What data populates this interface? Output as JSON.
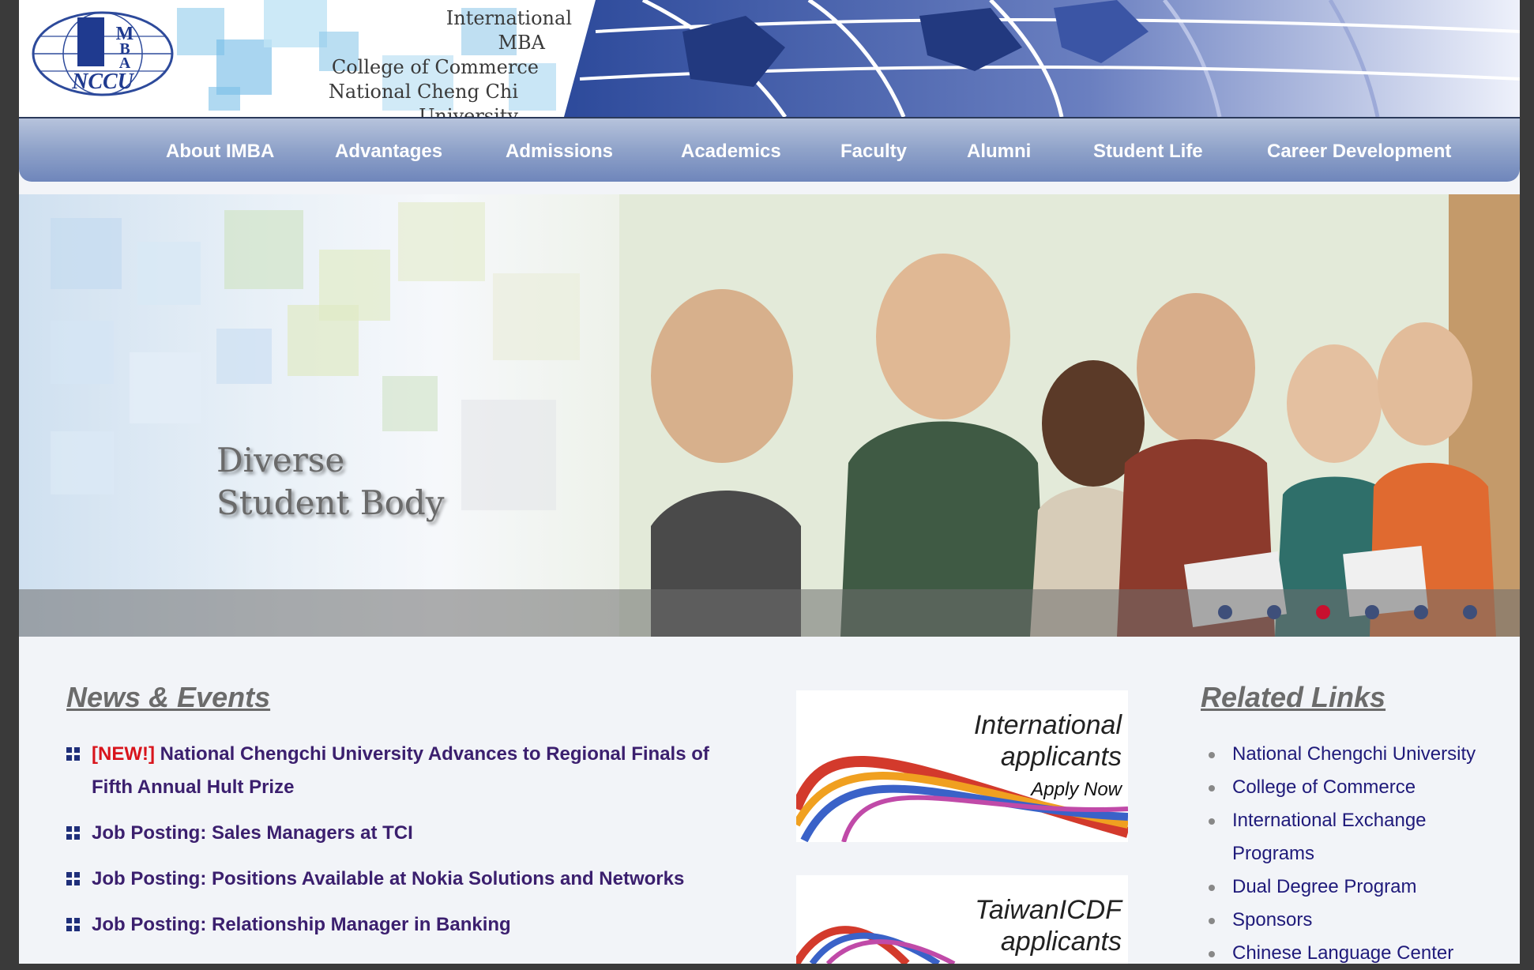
{
  "header": {
    "logo_text": "MBA NCCU",
    "title_lines": [
      "International",
      "MBA",
      "College of Commerce",
      "National Cheng Chi University"
    ]
  },
  "nav": {
    "items": [
      {
        "label": "About IMBA"
      },
      {
        "label": "Advantages"
      },
      {
        "label": "Admissions"
      },
      {
        "label": "Academics"
      },
      {
        "label": "Faculty"
      },
      {
        "label": "Alumni"
      },
      {
        "label": "Student Life"
      },
      {
        "label": "Career Development"
      }
    ]
  },
  "hero": {
    "caption_line1": "Diverse",
    "caption_line2": "Student Body",
    "slide_count": 6,
    "active_slide": 3
  },
  "news": {
    "title": "News & Events",
    "items": [
      {
        "new_tag": "[NEW!]",
        "line1": "National Chengchi University Advances to Regional Finals of",
        "line2": "Fifth Annual Hult Prize"
      },
      {
        "text": "Job Posting: Sales Managers at TCI"
      },
      {
        "text": "Job Posting: Positions Available at Nokia Solutions and Networks"
      },
      {
        "text": "Job Posting: Relationship Manager in Banking"
      }
    ]
  },
  "banners": [
    {
      "title_line1": "International",
      "title_line2": "applicants",
      "sub": "Apply Now"
    },
    {
      "title_line1": "TaiwanICDF",
      "title_line2": "applicants"
    }
  ],
  "related_links": {
    "title": "Related Links",
    "items": [
      "National Chengchi University",
      "College of Commerce",
      "International Exchange",
      "Programs",
      "Dual Degree Program",
      "Sponsors",
      "Chinese Language Center"
    ]
  },
  "colors": {
    "nav_gradient_top": "#b7c3dc",
    "nav_gradient_bottom": "#6f86bb",
    "link_purple": "#3b1f6e",
    "new_red": "#d8141c",
    "active_dot": "#c8102e"
  }
}
